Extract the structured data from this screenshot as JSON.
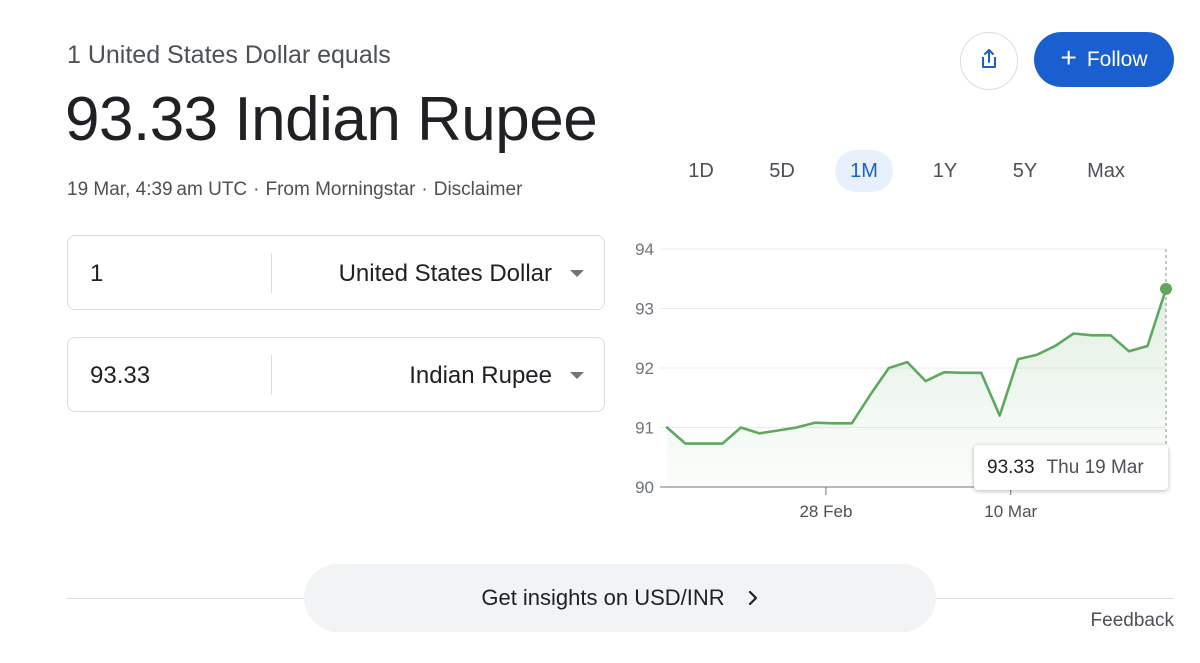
{
  "header": {
    "subtitle": "1 United States Dollar equals",
    "value": "93.33 Indian Rupee",
    "timestamp": "19 Mar, 4:39 am UTC",
    "sep": "·",
    "source": "From Morningstar",
    "disclaimer": "Disclaimer"
  },
  "actions": {
    "share_icon": "share-icon",
    "follow_label": "Follow",
    "follow_plus": "+"
  },
  "ranges": [
    {
      "label": "1D",
      "active": false
    },
    {
      "label": "5D",
      "active": false
    },
    {
      "label": "1M",
      "active": true
    },
    {
      "label": "1Y",
      "active": false
    },
    {
      "label": "5Y",
      "active": false
    },
    {
      "label": "Max",
      "active": false
    }
  ],
  "converter": {
    "from": {
      "amount": "1",
      "currency": "United States Dollar"
    },
    "to": {
      "amount": "93.33",
      "currency": "Indian Rupee"
    }
  },
  "chart_data": {
    "type": "area",
    "y_ticks": [
      "94",
      "93",
      "92",
      "91",
      "90"
    ],
    "ylim": [
      90,
      94
    ],
    "x_ticks": [
      "28 Feb",
      "10 Mar"
    ],
    "x_tick_positions": [
      8.6,
      18.6
    ],
    "values": [
      91.0,
      90.73,
      90.73,
      90.73,
      91.0,
      90.9,
      90.95,
      91.0,
      91.08,
      91.07,
      91.07,
      91.55,
      92.0,
      92.1,
      91.78,
      91.93,
      91.92,
      91.92,
      91.2,
      92.15,
      92.22,
      92.37,
      92.58,
      92.55,
      92.55,
      92.28,
      92.37,
      93.33
    ],
    "x_index_range": [
      0,
      27
    ],
    "line_color": "#5ea95f",
    "fill_color": "#e6f4e7",
    "grid": true,
    "tooltip": {
      "value": "93.33",
      "date": "Thu 19 Mar"
    }
  },
  "footer": {
    "insights_label": "Get insights on USD/INR",
    "feedback_label": "Feedback"
  }
}
